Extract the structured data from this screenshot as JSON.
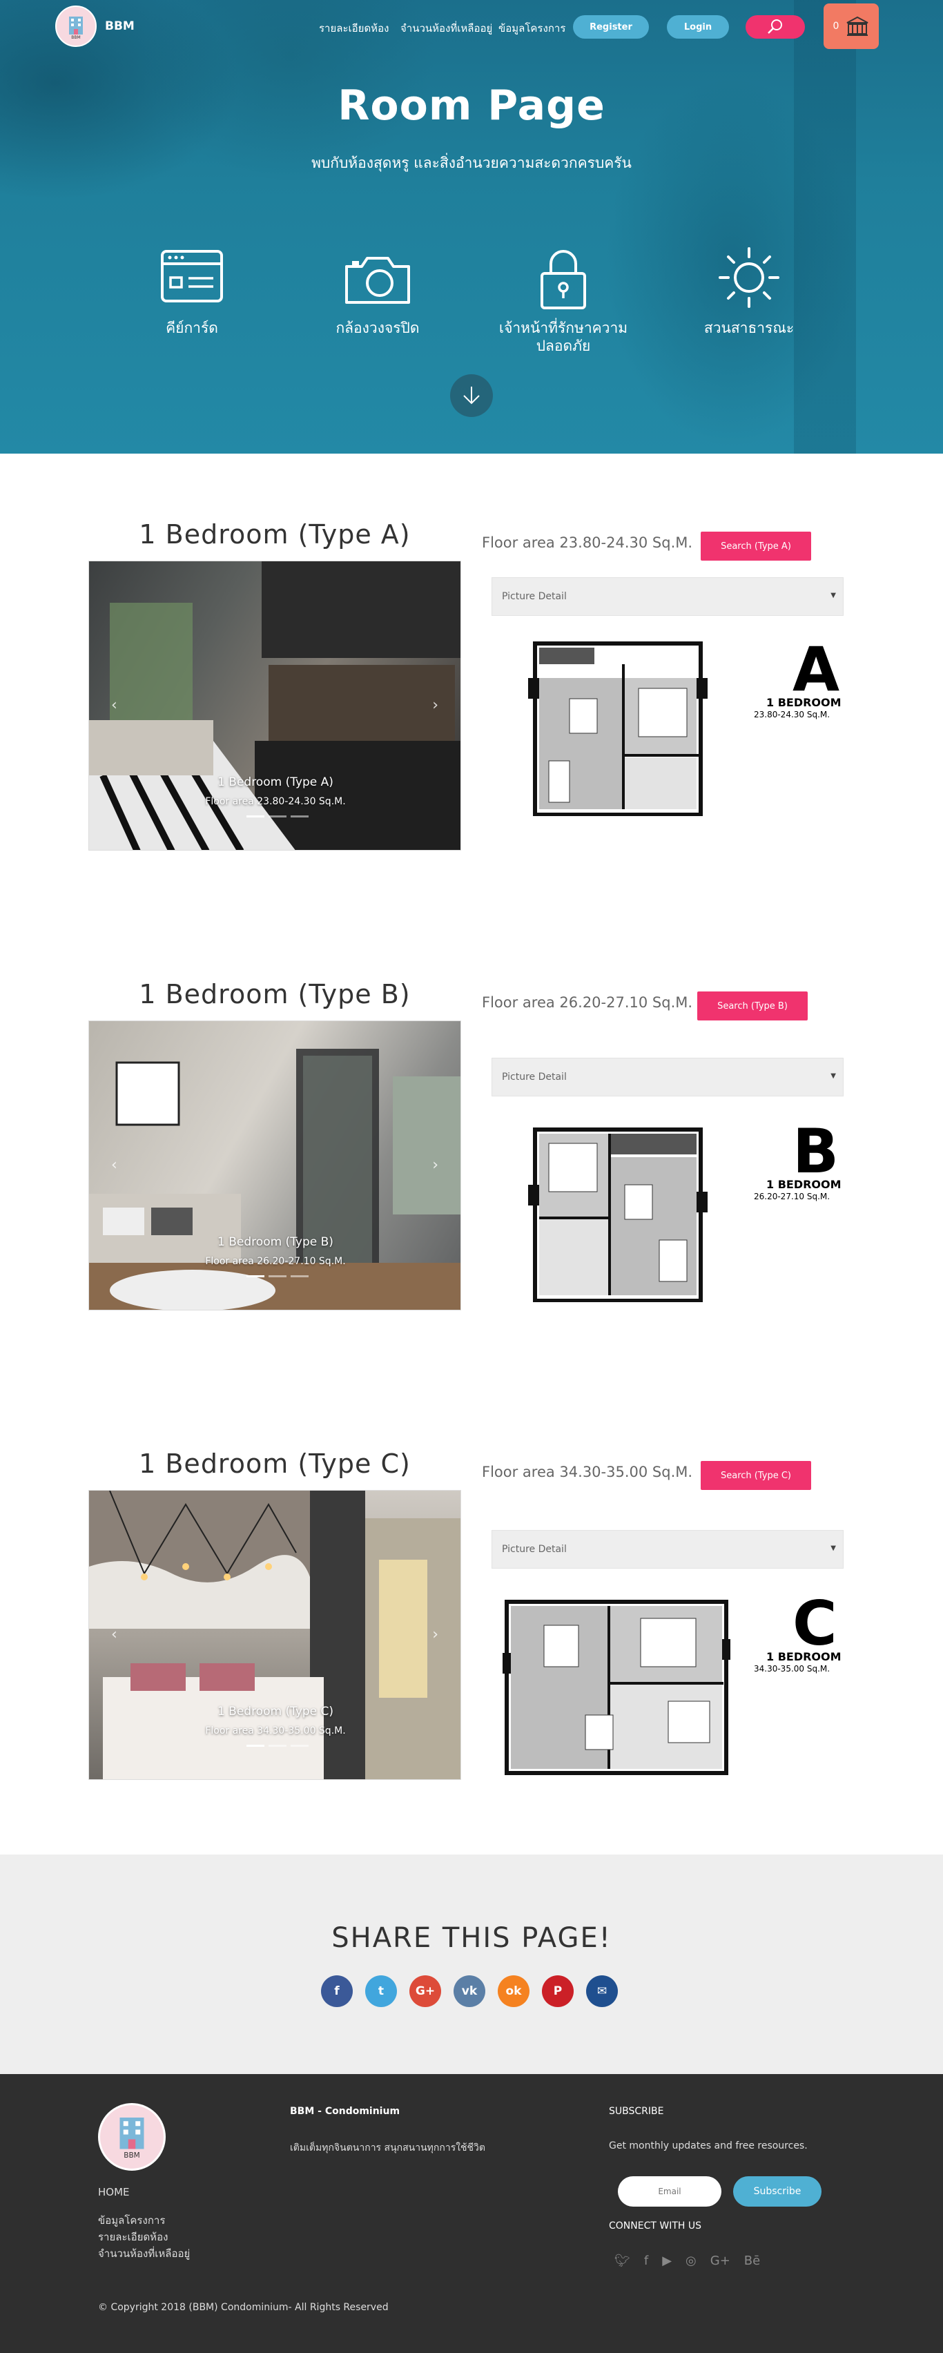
{
  "nav": {
    "brand": "BBM",
    "logo_text": "BBM",
    "links": [
      "รายละเอียดห้อง",
      "จำนวนห้องที่เหลืออยู่",
      "ข้อมูลโครงการ"
    ],
    "register": "Register",
    "login": "Login",
    "cart_count": "0"
  },
  "hero": {
    "title": "Room Page",
    "subtitle": "พบกับห้องสุดหรู และสิ่งอำนวยความสะดวกครบครัน",
    "features": [
      {
        "label": "คีย์การ์ด",
        "icon": "keycard-icon"
      },
      {
        "label": "กล้องวงจรปิด",
        "icon": "camera-icon"
      },
      {
        "label": "เจ้าหน้าที่รักษาความปลอดภัย",
        "icon": "lock-icon"
      },
      {
        "label": "สวนสาธารณะ",
        "icon": "sun-icon"
      }
    ]
  },
  "rooms": [
    {
      "title": "1 Bedroom (Type A)",
      "area_text": "Floor area 23.80-24.30 Sq.M.",
      "search_label": "Search (Type A)",
      "select_value": "Picture Detail",
      "caption_title": "1 Bedroom (Type A)",
      "caption_sub": "Floor area 23.80-24.30 Sq.M.",
      "plan_letter": "A",
      "plan_type": "1 BEDROOM",
      "plan_size": "23.80-24.30 Sq.M."
    },
    {
      "title": "1 Bedroom (Type B)",
      "area_text": "Floor area 26.20-27.10 Sq.M.",
      "search_label": "Search (Type B)",
      "select_value": "Picture Detail",
      "caption_title": "1 Bedroom (Type B)",
      "caption_sub": "Floor area 26.20-27.10 Sq.M.",
      "plan_letter": "B",
      "plan_type": "1 BEDROOM",
      "plan_size": "26.20-27.10 Sq.M."
    },
    {
      "title": "1 Bedroom (Type C)",
      "area_text": "Floor area 34.30-35.00 Sq.M.",
      "search_label": "Search (Type C)",
      "select_value": "Picture Detail",
      "caption_title": "1 Bedroom (Type C)",
      "caption_sub": "Floor area 34.30-35.00 Sq.M.",
      "plan_letter": "C",
      "plan_type": "1 BEDROOM",
      "plan_size": "34.30-35.00 Sq.M."
    }
  ],
  "share": {
    "title": "SHARE THIS PAGE!",
    "networks": [
      {
        "icon": "facebook-icon",
        "glyph": "f",
        "color": "#3b5998"
      },
      {
        "icon": "twitter-icon",
        "glyph": "t",
        "color": "#41a6dd"
      },
      {
        "icon": "google-plus-icon",
        "glyph": "G+",
        "color": "#dd4b39"
      },
      {
        "icon": "vk-icon",
        "glyph": "vk",
        "color": "#5b7fa6"
      },
      {
        "icon": "odnoklassniki-icon",
        "glyph": "ok",
        "color": "#f58220"
      },
      {
        "icon": "pinterest-icon",
        "glyph": "P",
        "color": "#cb2027"
      },
      {
        "icon": "mail-icon",
        "glyph": "✉",
        "color": "#1f4f8f"
      }
    ]
  },
  "footer": {
    "logo_text": "BBM",
    "home": "HOME",
    "links": [
      "ข้อมูลโครงการ",
      "รายละเอียดห้อง",
      "จำนวนห้องที่เหลืออยู่"
    ],
    "company_title": "BBM - Condominium",
    "company_text": "เติมเต็มทุกจินตนาการ สนุกสนานทุกการใช้ชีวิต",
    "subscribe_title": "SUBSCRIBE",
    "subscribe_text": "Get monthly updates and free resources.",
    "email_placeholder": "Email",
    "subscribe_button": "Subscribe",
    "connect_title": "CONNECT WITH US",
    "social": [
      "twitter-icon",
      "facebook-icon",
      "youtube-icon",
      "instagram-icon",
      "google-plus-icon",
      "behance-icon"
    ],
    "copyright": "© Copyright 2018 (BBM) Condominium- All Rights Reserved"
  }
}
